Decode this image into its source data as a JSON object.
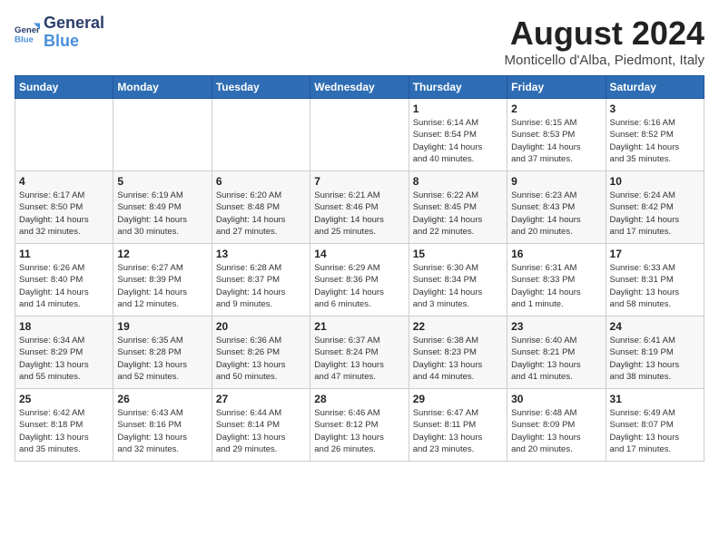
{
  "logo": {
    "line1": "General",
    "line2": "Blue"
  },
  "title": "August 2024",
  "location": "Monticello d'Alba, Piedmont, Italy",
  "weekdays": [
    "Sunday",
    "Monday",
    "Tuesday",
    "Wednesday",
    "Thursday",
    "Friday",
    "Saturday"
  ],
  "weeks": [
    [
      {
        "day": "",
        "info": ""
      },
      {
        "day": "",
        "info": ""
      },
      {
        "day": "",
        "info": ""
      },
      {
        "day": "",
        "info": ""
      },
      {
        "day": "1",
        "info": "Sunrise: 6:14 AM\nSunset: 8:54 PM\nDaylight: 14 hours\nand 40 minutes."
      },
      {
        "day": "2",
        "info": "Sunrise: 6:15 AM\nSunset: 8:53 PM\nDaylight: 14 hours\nand 37 minutes."
      },
      {
        "day": "3",
        "info": "Sunrise: 6:16 AM\nSunset: 8:52 PM\nDaylight: 14 hours\nand 35 minutes."
      }
    ],
    [
      {
        "day": "4",
        "info": "Sunrise: 6:17 AM\nSunset: 8:50 PM\nDaylight: 14 hours\nand 32 minutes."
      },
      {
        "day": "5",
        "info": "Sunrise: 6:19 AM\nSunset: 8:49 PM\nDaylight: 14 hours\nand 30 minutes."
      },
      {
        "day": "6",
        "info": "Sunrise: 6:20 AM\nSunset: 8:48 PM\nDaylight: 14 hours\nand 27 minutes."
      },
      {
        "day": "7",
        "info": "Sunrise: 6:21 AM\nSunset: 8:46 PM\nDaylight: 14 hours\nand 25 minutes."
      },
      {
        "day": "8",
        "info": "Sunrise: 6:22 AM\nSunset: 8:45 PM\nDaylight: 14 hours\nand 22 minutes."
      },
      {
        "day": "9",
        "info": "Sunrise: 6:23 AM\nSunset: 8:43 PM\nDaylight: 14 hours\nand 20 minutes."
      },
      {
        "day": "10",
        "info": "Sunrise: 6:24 AM\nSunset: 8:42 PM\nDaylight: 14 hours\nand 17 minutes."
      }
    ],
    [
      {
        "day": "11",
        "info": "Sunrise: 6:26 AM\nSunset: 8:40 PM\nDaylight: 14 hours\nand 14 minutes."
      },
      {
        "day": "12",
        "info": "Sunrise: 6:27 AM\nSunset: 8:39 PM\nDaylight: 14 hours\nand 12 minutes."
      },
      {
        "day": "13",
        "info": "Sunrise: 6:28 AM\nSunset: 8:37 PM\nDaylight: 14 hours\nand 9 minutes."
      },
      {
        "day": "14",
        "info": "Sunrise: 6:29 AM\nSunset: 8:36 PM\nDaylight: 14 hours\nand 6 minutes."
      },
      {
        "day": "15",
        "info": "Sunrise: 6:30 AM\nSunset: 8:34 PM\nDaylight: 14 hours\nand 3 minutes."
      },
      {
        "day": "16",
        "info": "Sunrise: 6:31 AM\nSunset: 8:33 PM\nDaylight: 14 hours\nand 1 minute."
      },
      {
        "day": "17",
        "info": "Sunrise: 6:33 AM\nSunset: 8:31 PM\nDaylight: 13 hours\nand 58 minutes."
      }
    ],
    [
      {
        "day": "18",
        "info": "Sunrise: 6:34 AM\nSunset: 8:29 PM\nDaylight: 13 hours\nand 55 minutes."
      },
      {
        "day": "19",
        "info": "Sunrise: 6:35 AM\nSunset: 8:28 PM\nDaylight: 13 hours\nand 52 minutes."
      },
      {
        "day": "20",
        "info": "Sunrise: 6:36 AM\nSunset: 8:26 PM\nDaylight: 13 hours\nand 50 minutes."
      },
      {
        "day": "21",
        "info": "Sunrise: 6:37 AM\nSunset: 8:24 PM\nDaylight: 13 hours\nand 47 minutes."
      },
      {
        "day": "22",
        "info": "Sunrise: 6:38 AM\nSunset: 8:23 PM\nDaylight: 13 hours\nand 44 minutes."
      },
      {
        "day": "23",
        "info": "Sunrise: 6:40 AM\nSunset: 8:21 PM\nDaylight: 13 hours\nand 41 minutes."
      },
      {
        "day": "24",
        "info": "Sunrise: 6:41 AM\nSunset: 8:19 PM\nDaylight: 13 hours\nand 38 minutes."
      }
    ],
    [
      {
        "day": "25",
        "info": "Sunrise: 6:42 AM\nSunset: 8:18 PM\nDaylight: 13 hours\nand 35 minutes."
      },
      {
        "day": "26",
        "info": "Sunrise: 6:43 AM\nSunset: 8:16 PM\nDaylight: 13 hours\nand 32 minutes."
      },
      {
        "day": "27",
        "info": "Sunrise: 6:44 AM\nSunset: 8:14 PM\nDaylight: 13 hours\nand 29 minutes."
      },
      {
        "day": "28",
        "info": "Sunrise: 6:46 AM\nSunset: 8:12 PM\nDaylight: 13 hours\nand 26 minutes."
      },
      {
        "day": "29",
        "info": "Sunrise: 6:47 AM\nSunset: 8:11 PM\nDaylight: 13 hours\nand 23 minutes."
      },
      {
        "day": "30",
        "info": "Sunrise: 6:48 AM\nSunset: 8:09 PM\nDaylight: 13 hours\nand 20 minutes."
      },
      {
        "day": "31",
        "info": "Sunrise: 6:49 AM\nSunset: 8:07 PM\nDaylight: 13 hours\nand 17 minutes."
      }
    ]
  ]
}
